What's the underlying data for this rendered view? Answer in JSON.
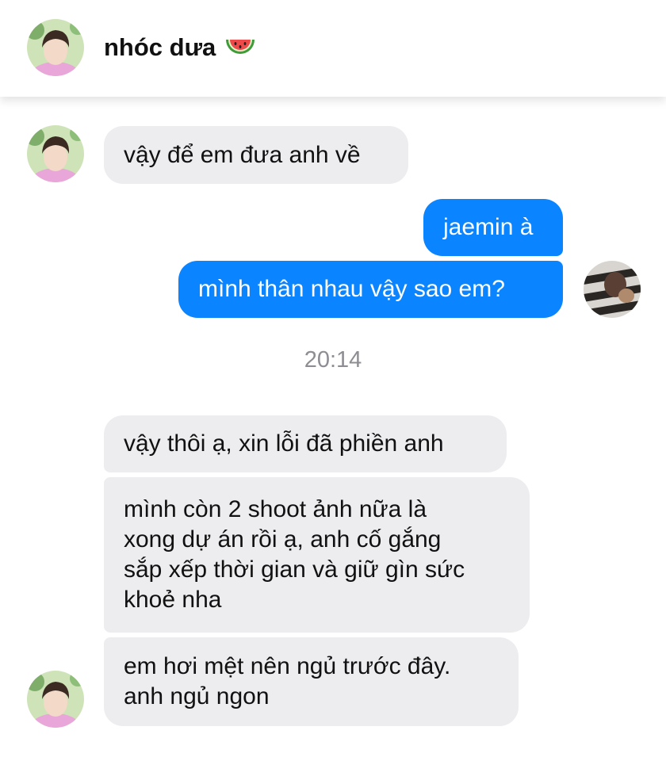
{
  "header": {
    "contact_name": "nhóc dưa",
    "emoji": "watermelon"
  },
  "conversation": {
    "messages_before": [
      {
        "sender": "contact",
        "text": "vậy để em đưa anh về"
      },
      {
        "sender": "me",
        "text": "jaemin à"
      },
      {
        "sender": "me",
        "text": "mình thân nhau vậy sao em?"
      }
    ],
    "timestamp": "20:14",
    "messages_after": [
      {
        "sender": "contact",
        "text": "vậy thôi ạ, xin lỗi đã phiền anh"
      },
      {
        "sender": "contact",
        "text": "mình còn 2 shoot ảnh nữa là\nxong dự án rồi ạ, anh cố gắng\nsắp xếp thời gian và giữ gìn sức\nkhoẻ nha"
      },
      {
        "sender": "contact",
        "text": "em hơi mệt nên ngủ trước đây.\nanh ngủ ngon"
      }
    ]
  },
  "colors": {
    "outgoing_bubble": "#0a84ff",
    "incoming_bubble": "#ededf0",
    "timestamp_text": "#8d8d93"
  }
}
